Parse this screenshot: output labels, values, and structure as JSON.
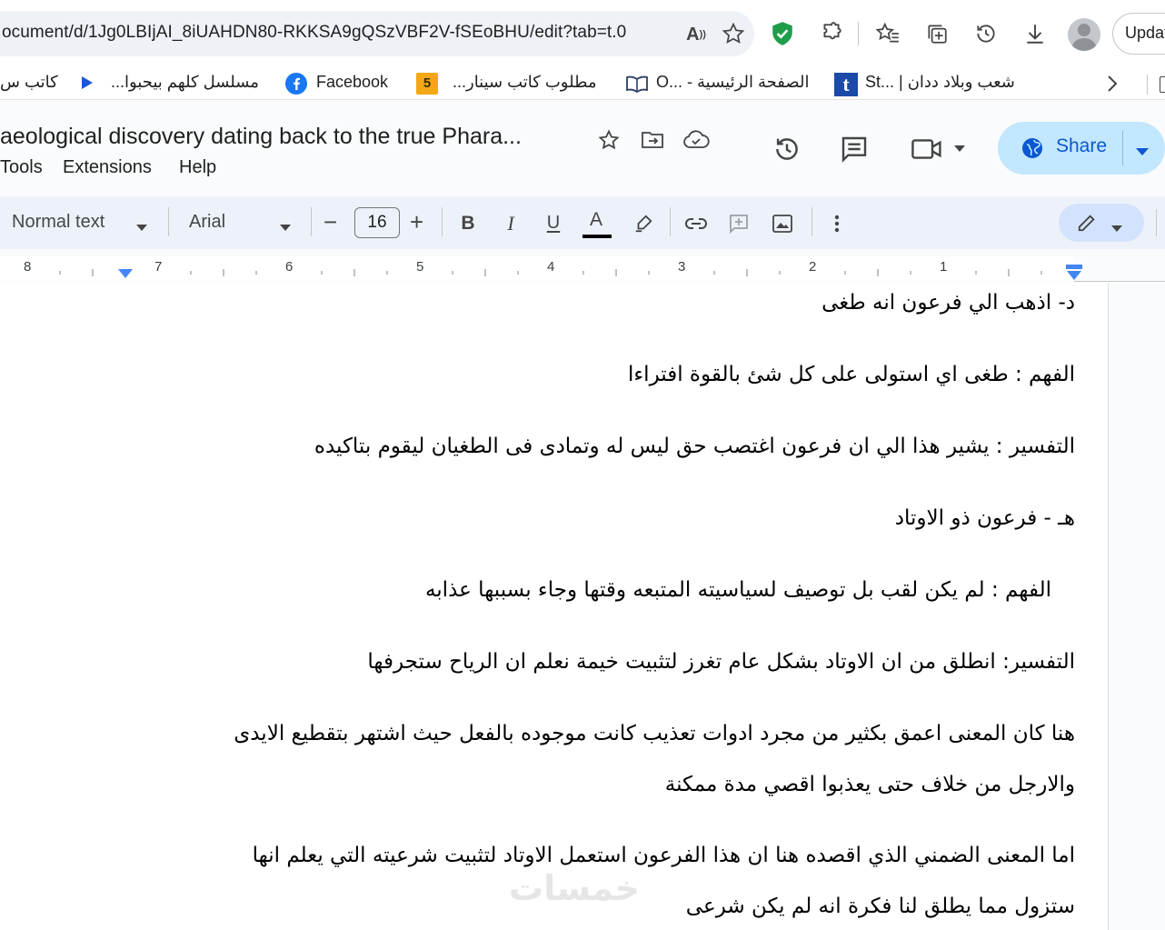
{
  "browser": {
    "url": "ocument/d/1Jg0LBIjAI_8iUAHDN80-RKKSA9gQSzVBF2V-fSEoBHU/edit?tab=t.0",
    "update_label": "Updat"
  },
  "bookmarks": [
    {
      "label": "كاتب س",
      "icon": "doc-icon"
    },
    {
      "label": "مسلسل كلهم بيحبوا...",
      "icon": "play-icon"
    },
    {
      "label": "Facebook",
      "icon": "facebook-icon"
    },
    {
      "label": "مطلوب كاتب سينار...",
      "icon": "five-icon"
    },
    {
      "label": "الصفحة الرئيسية - ...O",
      "icon": "book-icon"
    },
    {
      "label": "شعب وبلاد ددان | ...St",
      "icon": "t-icon"
    }
  ],
  "docs": {
    "title": "aeological discovery dating back to the true Phara...",
    "menus": [
      "Tools",
      "Extensions",
      "Help"
    ],
    "share_label": "Share"
  },
  "toolbar": {
    "style": "Normal text",
    "font": "Arial",
    "font_size": "16",
    "minus": "−",
    "plus": "+"
  },
  "ruler": {
    "numbers": [
      "8",
      "7",
      "6",
      "5",
      "4",
      "3",
      "2",
      "1"
    ]
  },
  "document": {
    "p1": "د- اذهب الي فرعون انه طغى",
    "p2": "الفهم : طغى اي استولى على كل شئ بالقوة افتراءا",
    "p3": "التفسير : يشير هذا الي ان فرعون اغتصب حق ليس له وتمادى فى الطغيان ليقوم بتاكيده",
    "p4": "هـ  - فرعون ذو الاوتاد",
    "p5": "الفهم : لم يكن لقب بل توصيف لسياسيته المتبعه وقتها وجاء بسببها عذابه",
    "p6": "التفسير: انطلق من ان الاوتاد بشكل عام تغرز لتثبيت خيمة نعلم ان الرياح ستجرفها",
    "p7a": "هنا كان المعنى اعمق بكثير من مجرد ادوات تعذيب كانت موجوده بالفعل حيث اشتهر بتقطيع الايدى",
    "p7b": "والارجل من خلاف حتى يعذبوا اقصي مدة ممكنة",
    "p8a": "اما المعنى الضمني الذي اقصده هنا  ان هذا الفرعون استعمل الاوتاد لتثبيت شرعيته التي يعلم انها",
    "p8b": "ستزول مما يطلق لنا فكرة انه لم يكن شرعى"
  },
  "watermark": "خمسات",
  "colors": {
    "share_bg": "#c2e7ff",
    "share_text": "#0b57d0",
    "toolbar_bg": "#edf2fa",
    "spell_underline": "#e51c23",
    "ruler_marker": "#4285f4"
  }
}
